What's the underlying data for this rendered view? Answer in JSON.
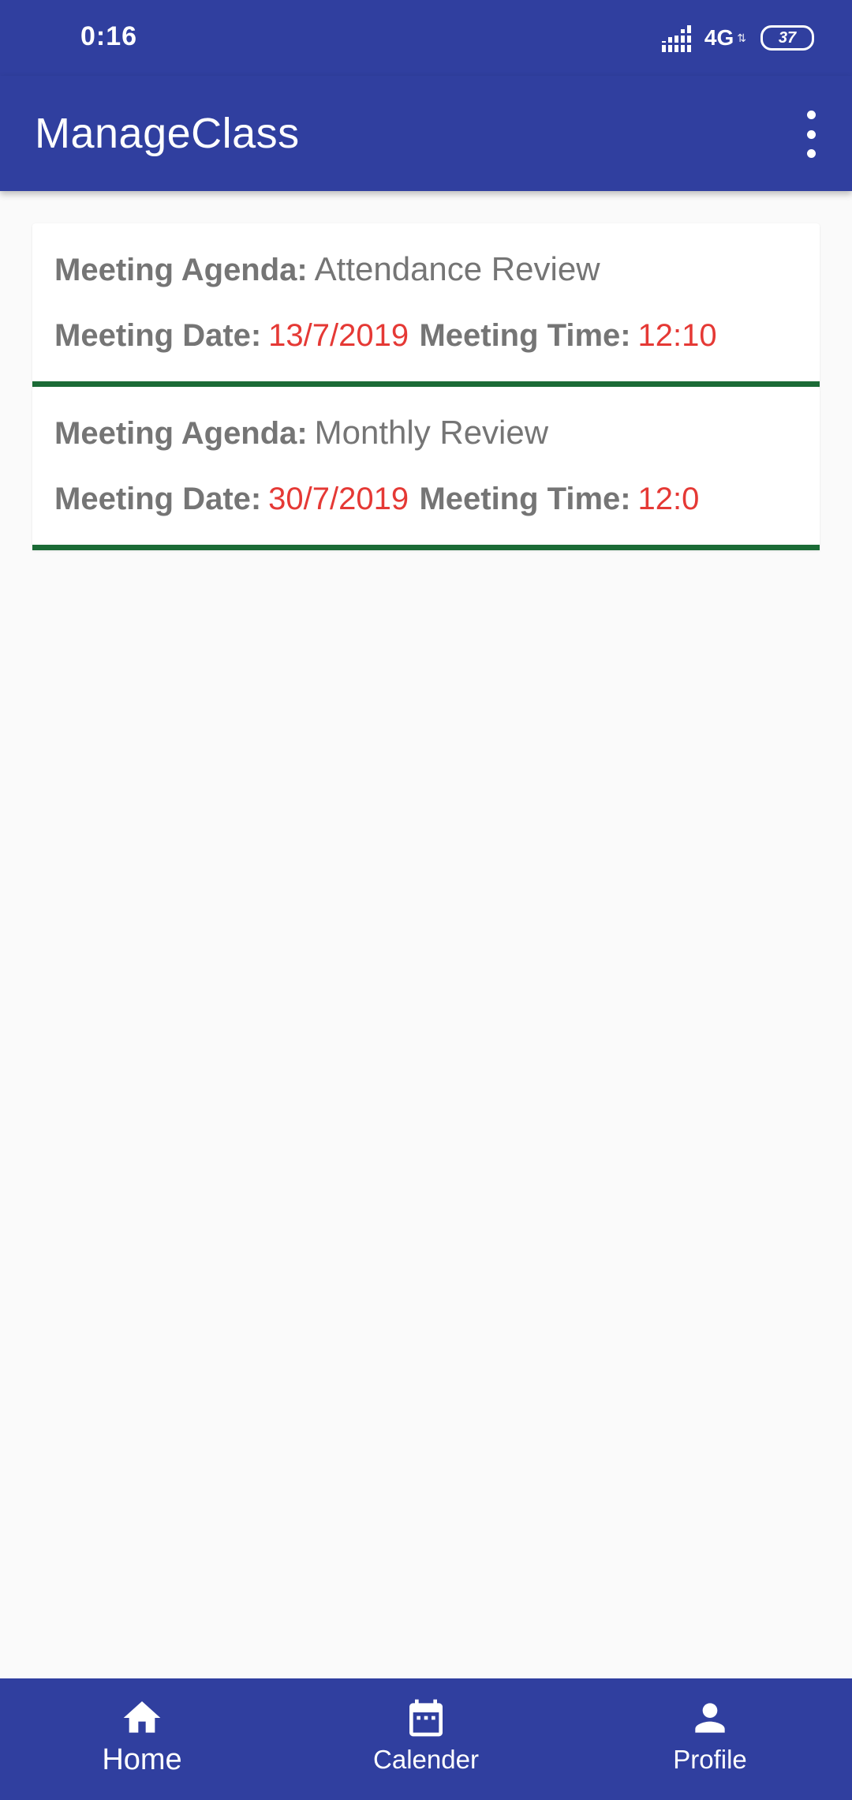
{
  "status_bar": {
    "time": "0:16",
    "network": "4G",
    "battery": "37",
    "icons": [
      "signal-icon",
      "battery-icon"
    ]
  },
  "app_bar": {
    "title": "ManageClass",
    "overflow_icon": "more-vert-icon"
  },
  "meetings": [
    {
      "agenda_label": "Meeting Agenda:",
      "agenda": "Attendance Review",
      "date_label": "Meeting Date:",
      "date": "13/7/2019",
      "time_label": "Meeting Time:",
      "time": "12:10"
    },
    {
      "agenda_label": "Meeting Agenda:",
      "agenda": "Monthly Review",
      "date_label": "Meeting Date:",
      "date": "30/7/2019",
      "time_label": "Meeting Time:",
      "time": "12:0"
    }
  ],
  "bottom_nav": [
    {
      "label": "Home",
      "icon": "home-icon",
      "active": true
    },
    {
      "label": "Calender",
      "icon": "calendar-icon",
      "active": false
    },
    {
      "label": "Profile",
      "icon": "person-icon",
      "active": false
    }
  ],
  "colors": {
    "primary": "#303f9f",
    "card_border": "#1b6b36",
    "value_red": "#e53935",
    "label_gray": "#757575",
    "background": "#fafafa"
  }
}
